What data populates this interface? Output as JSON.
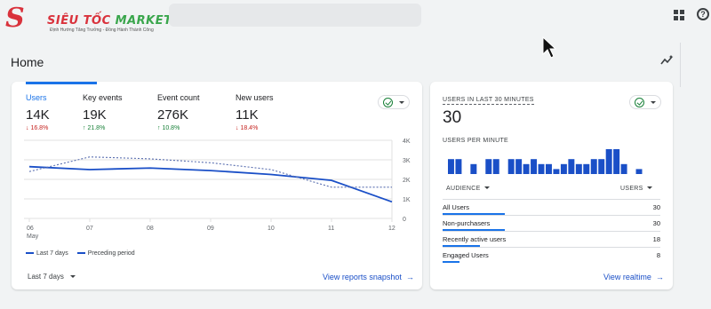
{
  "brand": {
    "name": "SIÊU TỐC",
    "name_accent": "MARKETING",
    "tagline": "Định Hướng Tăng Trưởng - Đồng Hành Thành Công"
  },
  "page": {
    "title": "Home"
  },
  "metrics": [
    {
      "label": "Users",
      "value": "14K",
      "change": "16.8%",
      "direction": "down"
    },
    {
      "label": "Key events",
      "value": "19K",
      "change": "21.8%",
      "direction": "up"
    },
    {
      "label": "Event count",
      "value": "276K",
      "change": "10.8%",
      "direction": "up"
    },
    {
      "label": "New users",
      "value": "11K",
      "change": "18.4%",
      "direction": "down"
    }
  ],
  "chart_data": {
    "type": "line",
    "x": [
      "06 May",
      "07",
      "08",
      "09",
      "10",
      "11",
      "12"
    ],
    "x_ticks": [
      "06",
      "07",
      "08",
      "09",
      "10",
      "11",
      "12"
    ],
    "x_subtick": "May",
    "y_ticks": [
      "4K",
      "3K",
      "2K",
      "1K",
      "0"
    ],
    "ylim": [
      0,
      4000
    ],
    "series": [
      {
        "name": "Last 7 days",
        "style": "solid",
        "values": [
          2650,
          2500,
          2580,
          2450,
          2250,
          1950,
          850
        ]
      },
      {
        "name": "Preceding period",
        "style": "dashed",
        "values": [
          2400,
          3150,
          3050,
          2850,
          2500,
          1600,
          1600
        ]
      }
    ],
    "colors": {
      "line": "#1a4fc7",
      "grid": "#e0e0e0",
      "axis_text": "#5f6368"
    }
  },
  "legend": {
    "last": "Last 7 days",
    "preceding": "Preceding period"
  },
  "controls": {
    "date_range": "Last 7 days",
    "view_snapshot": "View reports snapshot",
    "arrow": "→"
  },
  "realtime": {
    "title": "USERS IN LAST 30 MINUTES",
    "value": "30",
    "per_minute_label": "USERS PER MINUTE",
    "bars": [
      3,
      3,
      0,
      2,
      0,
      3,
      3,
      0,
      3,
      3,
      2,
      3,
      2,
      2,
      1,
      2,
      3,
      2,
      2,
      3,
      3,
      5,
      5,
      2,
      0,
      1
    ],
    "bar_max": 5,
    "col_audience": "AUDIENCE",
    "col_users": "USERS",
    "rows": [
      {
        "label": "All Users",
        "value": "30",
        "count": 30
      },
      {
        "label": "Non-purchasers",
        "value": "30",
        "count": 30
      },
      {
        "label": "Recently active users",
        "value": "18",
        "count": 18
      },
      {
        "label": "Engaged Users",
        "value": "8",
        "count": 8
      }
    ],
    "view_link": "View realtime",
    "arrow": "→"
  },
  "colors": {
    "accent": "#1a73e8",
    "down": "#c5221f",
    "up": "#188038",
    "bar": "#1a4fc7",
    "brand_red": "#d9323c",
    "brand_green": "#3aa64c"
  }
}
